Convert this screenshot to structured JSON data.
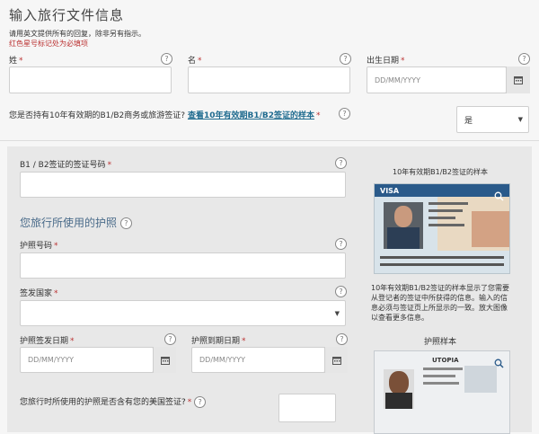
{
  "header": {
    "title": "输入旅行文件信息",
    "instruction": "请用英文提供所有的回复，除非另有指示。",
    "required_note": "红色星号标记处为必填项"
  },
  "fields": {
    "last_name_label": "姓",
    "first_name_label": "名",
    "dob_label": "出生日期",
    "dob_placeholder": "DD/MM/YYYY",
    "visa_question": "您是否持有10年有效期的B1/B2商务或旅游签证?",
    "visa_sample_link": "查看10年有效期B1/B2签证的样本",
    "visa_answer": "是",
    "visa_number_label": "B1 / B2签证的签证号码",
    "passport_section": "您旅行所使用的护照",
    "passport_number_label": "护照号码",
    "issuing_country_label": "签发国家",
    "issue_date_label": "护照签发日期",
    "issue_date_placeholder": "DD/MM/YYYY",
    "expiry_date_label": "护照到期日期",
    "expiry_date_placeholder": "DD/MM/YYYY",
    "us_visa_question": "您旅行时所使用的护照是否含有您的美国签证?"
  },
  "sidebar": {
    "visa_sample_title": "10年有效期B1/B2签证的样本",
    "visa_card_text": "VISA",
    "visa_sample_note": "10年有效期B1/B2签证的样本显示了您需要从登记者的签证中所获得的信息。输入的信息必须与签证页上所显示的一致。放大图像以查看更多信息。",
    "passport_sample_title": "护照样本",
    "passport_card_text": "UTOPIA"
  },
  "symbols": {
    "asterisk": "*",
    "help": "?",
    "caret": "▼"
  }
}
